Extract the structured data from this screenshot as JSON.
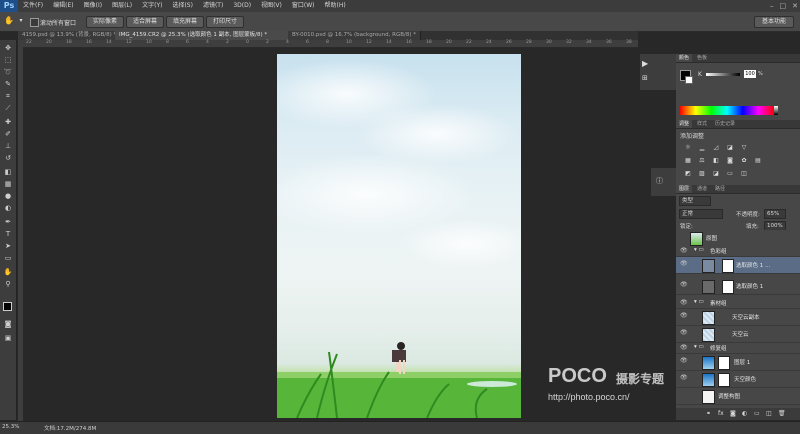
{
  "app": {
    "logo": "Ps"
  },
  "menu": [
    "文件(F)",
    "编辑(E)",
    "图像(I)",
    "图层(L)",
    "文字(Y)",
    "选择(S)",
    "滤镜(T)",
    "3D(D)",
    "视图(V)",
    "窗口(W)",
    "帮助(H)"
  ],
  "window_controls": [
    "–",
    "□",
    "✕"
  ],
  "options_bar": {
    "scroll_all_label": "滚动所有窗口",
    "actual_pixels": "实际像素",
    "fit_screen": "适合屏幕",
    "fill_screen": "填充屏幕",
    "print_size": "打印尺寸",
    "workspace": "基本功能"
  },
  "tabs": [
    "4159.psd @ 13.9% (背景, RGB/8) *",
    "IMG_4159.CR2 @ 25.3% (选取颜色 1 副本, 图层蒙板/8) *",
    "BY-0010.psd @ 16.7% (background, RGB/8) *"
  ],
  "ruler_ticks": [
    "22",
    "20",
    "18",
    "16",
    "14",
    "12",
    "10",
    "8",
    "6",
    "4",
    "2",
    "0",
    "2",
    "4",
    "6",
    "8",
    "10",
    "12",
    "14",
    "16",
    "18",
    "20",
    "22",
    "24",
    "26",
    "28",
    "30",
    "32",
    "34",
    "36",
    "38"
  ],
  "color_panel": {
    "tabs": [
      "颜色",
      "色板"
    ],
    "channel": "K",
    "value": "100",
    "unit": "%"
  },
  "adjust_panel": {
    "tabs": [
      "调整",
      "样式",
      "历史记录"
    ],
    "title": "添加调整"
  },
  "layers_panel": {
    "tabs": [
      "图层",
      "通道",
      "路径"
    ],
    "filter": "类型",
    "blend_mode": "正常",
    "opacity_label": "不透明度:",
    "opacity": "65%",
    "lock_label": "锁定:",
    "fill_label": "填充:",
    "fill": "100%",
    "layers": [
      {
        "name": "原图",
        "type": "layer"
      },
      {
        "name": "色彩组",
        "type": "group"
      },
      {
        "name": "选取颜色 1 ...",
        "type": "adj",
        "selected": true
      },
      {
        "name": "选取颜色 1",
        "type": "adj"
      },
      {
        "name": "素材组",
        "type": "group"
      },
      {
        "name": "天空云副本",
        "type": "sky"
      },
      {
        "name": "天空云",
        "type": "sky"
      },
      {
        "name": "修复组",
        "type": "group"
      },
      {
        "name": "图层 1",
        "type": "blue"
      },
      {
        "name": "天空颜色",
        "type": "blue"
      },
      {
        "name": "调整构图",
        "type": "white"
      }
    ]
  },
  "status": {
    "zoom": "25.3%",
    "doc": "文档:17.2M/274.8M"
  },
  "watermark": {
    "brand": "POCO",
    "title": "摄影专题",
    "url": "http://photo.poco.cn/"
  }
}
